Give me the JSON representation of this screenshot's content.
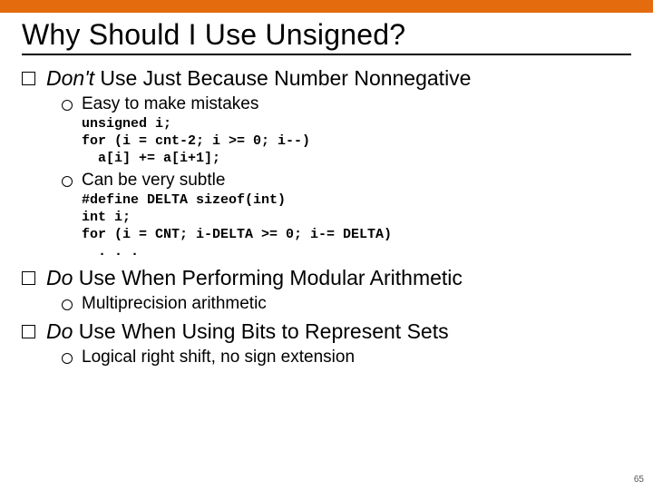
{
  "title": "Why Should I Use Unsigned?",
  "points": [
    {
      "em": "Don't",
      "rest": " Use Just Because Number Nonnegative",
      "subs": [
        {
          "text": "Easy to make mistakes"
        },
        {
          "text": "Can be very subtle"
        }
      ],
      "code1": "unsigned i;\nfor (i = cnt-2; i >= 0; i--)\n  a[i] += a[i+1];",
      "code2": "#define DELTA sizeof(int)\nint i;\nfor (i = CNT; i-DELTA >= 0; i-= DELTA)\n  . . ."
    },
    {
      "em": "Do",
      "rest": " Use When Performing Modular Arithmetic",
      "subs": [
        {
          "text": "Multiprecision arithmetic"
        }
      ]
    },
    {
      "em": "Do",
      "rest": " Use When Using Bits to Represent Sets",
      "subs": [
        {
          "text": "Logical right shift, no sign extension"
        }
      ]
    }
  ],
  "page_number": "65"
}
